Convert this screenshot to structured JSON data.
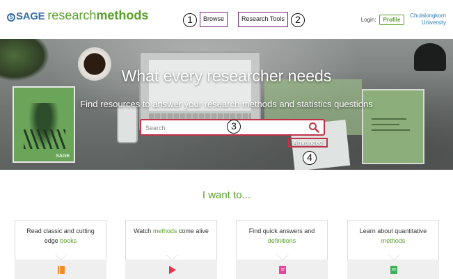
{
  "header": {
    "logo": {
      "sage_text": "SAGE",
      "sage_glyph": "S",
      "rm_plain": "research",
      "rm_bold": "methods"
    },
    "nav": [
      {
        "label": "Browse",
        "callout": "1"
      },
      {
        "label": "Research Tools",
        "callout": "2"
      }
    ],
    "login_label": "Login:",
    "profile_label": "Profile",
    "institution_line1": "Chulalongkorn",
    "institution_line2": "University"
  },
  "hero": {
    "title": "What every researcher needs",
    "subtitle": "Find resources to answer your research methods and statistics questions",
    "search_placeholder": "Search",
    "search_callout": "3",
    "advanced_label": "Advanced",
    "advanced_callout": "4",
    "book_label": "SAGE"
  },
  "want": {
    "title": "I want to...",
    "cards": [
      {
        "text_pre": "Read classic and cutting edge ",
        "text_link": "books",
        "text_post": "",
        "icon": "book-icon",
        "icon_color": "#f28c28"
      },
      {
        "text_pre": "Watch ",
        "text_link": "methods",
        "text_post": " come alive",
        "icon": "play-icon",
        "icon_color": "#e8334a"
      },
      {
        "text_pre": "Find quick answers and ",
        "text_link": "definitions",
        "text_post": "",
        "icon": "dictionary-icon",
        "icon_color": "#e0489a"
      },
      {
        "text_pre": "Learn about quantitative ",
        "text_link": "methods",
        "text_post": "",
        "icon": "datasets-icon",
        "icon_color": "#3fae5a"
      }
    ]
  },
  "colors": {
    "brand_green": "#5aa02c",
    "brand_blue": "#3a6ea5",
    "highlight_red": "#c23248",
    "callout_purple": "#7b2b7b"
  }
}
